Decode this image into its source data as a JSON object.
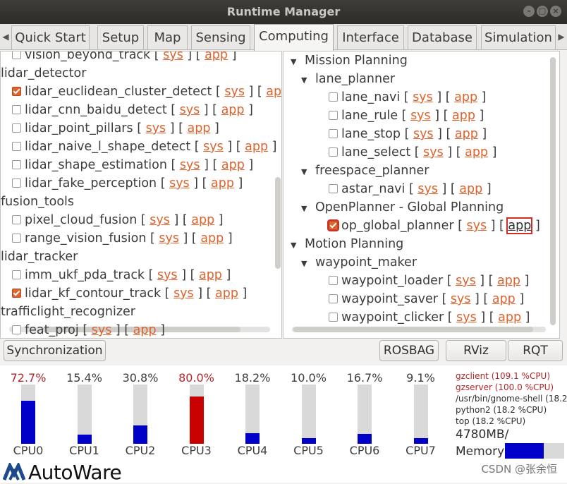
{
  "window": {
    "title": "Runtime Manager"
  },
  "tabs": [
    {
      "label": "Quick Start",
      "active": false
    },
    {
      "label": "Setup",
      "active": false
    },
    {
      "label": "Map",
      "active": false
    },
    {
      "label": "Sensing",
      "active": false
    },
    {
      "label": "Computing",
      "active": true
    },
    {
      "label": "Interface",
      "active": false
    },
    {
      "label": "Database",
      "active": false
    },
    {
      "label": "Simulation",
      "active": false
    }
  ],
  "left_tree": [
    {
      "type": "item",
      "label": "vision_beyond_track",
      "checked": false,
      "sys": "sys",
      "app": "app"
    },
    {
      "type": "group",
      "label": "lidar_detector"
    },
    {
      "type": "item",
      "label": "lidar_euclidean_cluster_detect",
      "checked": true,
      "sys": "sys",
      "app": "app"
    },
    {
      "type": "item",
      "label": "lidar_cnn_baidu_detect",
      "checked": false,
      "sys": "sys",
      "app": "app"
    },
    {
      "type": "item",
      "label": "lidar_point_pillars",
      "checked": false,
      "sys": "sys",
      "app": "app"
    },
    {
      "type": "item",
      "label": "lidar_naive_l_shape_detect",
      "checked": false,
      "sys": "sys",
      "app": "app"
    },
    {
      "type": "item",
      "label": "lidar_shape_estimation",
      "checked": false,
      "sys": "sys",
      "app": "app"
    },
    {
      "type": "item",
      "label": "lidar_fake_perception",
      "checked": false,
      "sys": "sys",
      "app": "app"
    },
    {
      "type": "group",
      "label": "fusion_tools"
    },
    {
      "type": "item",
      "label": "pixel_cloud_fusion",
      "checked": false,
      "sys": "sys",
      "app": "app"
    },
    {
      "type": "item",
      "label": "range_vision_fusion",
      "checked": false,
      "sys": "sys",
      "app": "app"
    },
    {
      "type": "group",
      "label": "lidar_tracker"
    },
    {
      "type": "item",
      "label": "imm_ukf_pda_track",
      "checked": false,
      "sys": "sys",
      "app": "app"
    },
    {
      "type": "item",
      "label": "lidar_kf_contour_track",
      "checked": true,
      "sys": "sys",
      "app": "app"
    },
    {
      "type": "group",
      "label": "trafficlight_recognizer"
    },
    {
      "type": "item",
      "label": "feat_proj",
      "checked": false,
      "sys": "sys",
      "app": "app"
    }
  ],
  "right_tree": [
    {
      "type": "group",
      "level": 0,
      "label": "Mission Planning"
    },
    {
      "type": "group",
      "level": 1,
      "label": "lane_planner"
    },
    {
      "type": "item",
      "level": 2,
      "label": "lane_navi",
      "checked": false,
      "sys": "sys",
      "app": "app"
    },
    {
      "type": "item",
      "level": 2,
      "label": "lane_rule",
      "checked": false,
      "sys": "sys",
      "app": "app"
    },
    {
      "type": "item",
      "level": 2,
      "label": "lane_stop",
      "checked": false,
      "sys": "sys",
      "app": "app"
    },
    {
      "type": "item",
      "level": 2,
      "label": "lane_select",
      "checked": false,
      "sys": "sys",
      "app": "app"
    },
    {
      "type": "group",
      "level": 1,
      "label": "freespace_planner"
    },
    {
      "type": "item",
      "level": 2,
      "label": "astar_navi",
      "checked": false,
      "sys": "sys",
      "app": "app"
    },
    {
      "type": "group",
      "level": 1,
      "label": "OpenPlanner - Global Planning"
    },
    {
      "type": "item",
      "level": 2,
      "label": "op_global_planner",
      "checked": true,
      "sys": "sys",
      "app": "app",
      "highlight": true
    },
    {
      "type": "group",
      "level": 0,
      "label": "Motion Planning"
    },
    {
      "type": "group",
      "level": 1,
      "label": "waypoint_maker"
    },
    {
      "type": "item",
      "level": 2,
      "label": "waypoint_loader",
      "checked": false,
      "sys": "sys",
      "app": "app"
    },
    {
      "type": "item",
      "level": 2,
      "label": "waypoint_saver",
      "checked": false,
      "sys": "sys",
      "app": "app"
    },
    {
      "type": "item",
      "level": 2,
      "label": "waypoint_clicker",
      "checked": false,
      "sys": "sys",
      "app": "app"
    }
  ],
  "buttons": {
    "synchronization": "Synchronization",
    "rosbag": "ROSBAG",
    "rviz": "RViz",
    "rqt": "RQT"
  },
  "cpus": [
    {
      "label": "CPU0",
      "percent_text": "72.7%",
      "value": 72.7
    },
    {
      "label": "CPU1",
      "percent_text": "15.4%",
      "value": 15.4
    },
    {
      "label": "CPU2",
      "percent_text": "30.8%",
      "value": 30.8
    },
    {
      "label": "CPU3",
      "percent_text": "80.0%",
      "value": 80.0
    },
    {
      "label": "CPU4",
      "percent_text": "18.2%",
      "value": 18.2
    },
    {
      "label": "CPU5",
      "percent_text": "10.0%",
      "value": 10.0
    },
    {
      "label": "CPU6",
      "percent_text": "16.7%",
      "value": 16.7
    },
    {
      "label": "CPU7",
      "percent_text": "9.1%",
      "value": 9.1
    }
  ],
  "processes": [
    {
      "text": "gzclient (109.1 %CPU)",
      "hot": true
    },
    {
      "text": "gzserver (100.0 %CPU)",
      "hot": true
    },
    {
      "text": "/usr/bin/gnome-shell (18.2",
      "hot": false
    },
    {
      "text": "python2 (18.2 %CPU)",
      "hot": false
    },
    {
      "text": "top (18.2 %CPU)",
      "hot": false
    }
  ],
  "memory": {
    "value_text": "4780MB/",
    "label": "Memory",
    "fraction": 0.65
  },
  "colors": {
    "link": "#e0632c",
    "cpu_fill": "#0000c8",
    "cpu_fill_hot": "#c80000",
    "highlight": "#d42b2b"
  },
  "logo": {
    "text": "AutoWare"
  },
  "watermark": "CSDN @张余恒"
}
